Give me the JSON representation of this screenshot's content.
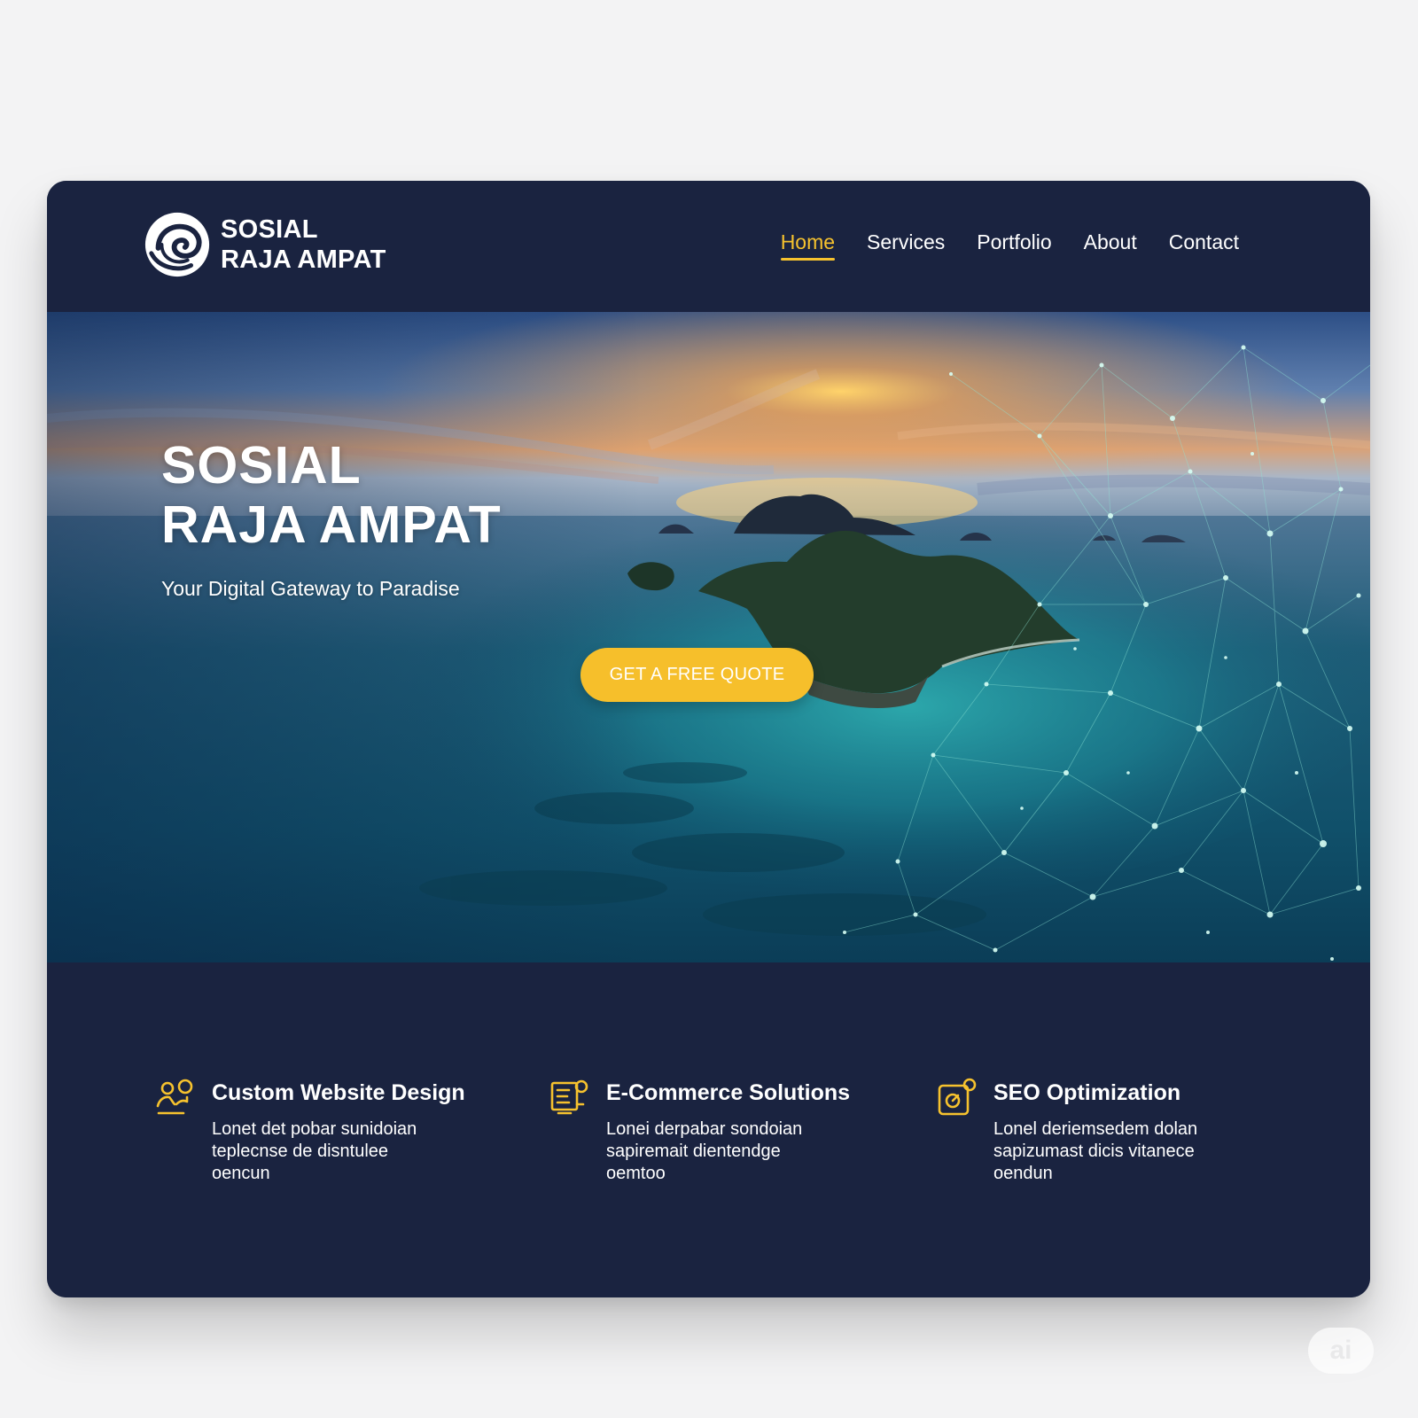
{
  "brand": {
    "name_line1": "SOSIAL",
    "name_line2": "RAJA AMPAT",
    "logo_icon": "wave-swirl-icon"
  },
  "nav": {
    "items": [
      {
        "label": "Home",
        "active": true
      },
      {
        "label": "Services",
        "active": false
      },
      {
        "label": "Portfolio",
        "active": false
      },
      {
        "label": "About",
        "active": false
      },
      {
        "label": "Contact",
        "active": false
      }
    ]
  },
  "hero": {
    "title_line1": "SOSIAL",
    "title_line2": "RAJA AMPAT",
    "subtitle": "Your Digital Gateway to Paradise",
    "cta_label": "GET A FREE QUOTE"
  },
  "features": [
    {
      "icon": "users-icon",
      "title": "Custom Website Design",
      "text_lines": [
        "Lonet det pobar sunidoian",
        "teplecnse de disntulee",
        "oencun"
      ]
    },
    {
      "icon": "storefront-icon",
      "title": "E-Commerce Solutions",
      "text_lines": [
        "Lonei derpabar sondoian",
        "sapiremait dientendge",
        "oemtoo"
      ]
    },
    {
      "icon": "search-chart-icon",
      "title": "SEO Optimization",
      "text_lines": [
        "Lonel deriemsedem dolan",
        "sapizumast dicis vitanece",
        "oendun"
      ]
    }
  ],
  "watermark": "ai",
  "colors": {
    "navy": "#1a2340",
    "accent": "#f6c22e",
    "text": "#ffffff"
  }
}
